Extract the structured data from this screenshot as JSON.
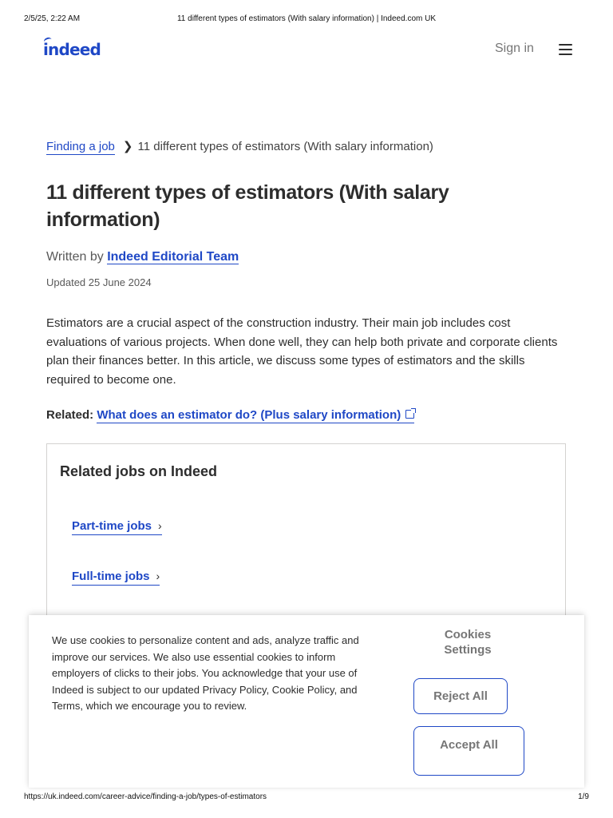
{
  "print_header": {
    "datetime": "2/5/25, 2:22 AM",
    "page_title": "11 different types of estimators (With salary information) | Indeed.com UK"
  },
  "header": {
    "logo_text": "indeed",
    "signin_label": "Sign in",
    "menu_icon": "hamburger-menu-icon"
  },
  "breadcrumb": {
    "parent_label": "Finding a job",
    "separator_icon": "chevron-right-icon",
    "current_label": "11 different types of estimators (With salary information)"
  },
  "article": {
    "title": "11 different types of estimators (With salary information)",
    "written_by_prefix": "Written by",
    "author": "Indeed Editorial Team",
    "updated": "Updated 25 June 2024",
    "intro": "Estimators are a crucial aspect of the construction industry. Their main job includes cost evaluations of various projects. When done well, they can help both private and corporate clients plan their finances better. In this article, we discuss some types of estimators and the skills required to become one.",
    "related_label": "Related:",
    "related_link": "What does an estimator do? (Plus salary information)",
    "related_link_icon": "external-link-icon"
  },
  "related_jobs": {
    "heading": "Related jobs on Indeed",
    "links": [
      {
        "label": "Part-time jobs"
      },
      {
        "label": "Full-time jobs"
      }
    ]
  },
  "cookie_banner": {
    "text": "We use cookies to personalize content and ads, analyze traffic and improve our services. We also use essential cookies to inform employers of clicks to their jobs. You acknowledge that your use of Indeed is subject to our updated Privacy Policy, Cookie Policy, and Terms, which we encourage you to review.",
    "settings_label": "Cookies Settings",
    "reject_label": "Reject All",
    "accept_label": "Accept All"
  },
  "print_footer": {
    "url": "https://uk.indeed.com/career-advice/finding-a-job/types-of-estimators",
    "page_number": "1/9"
  },
  "colors": {
    "brand_blue": "#1f48c6",
    "text_dark": "#2d2d2d",
    "text_muted": "#767676"
  }
}
